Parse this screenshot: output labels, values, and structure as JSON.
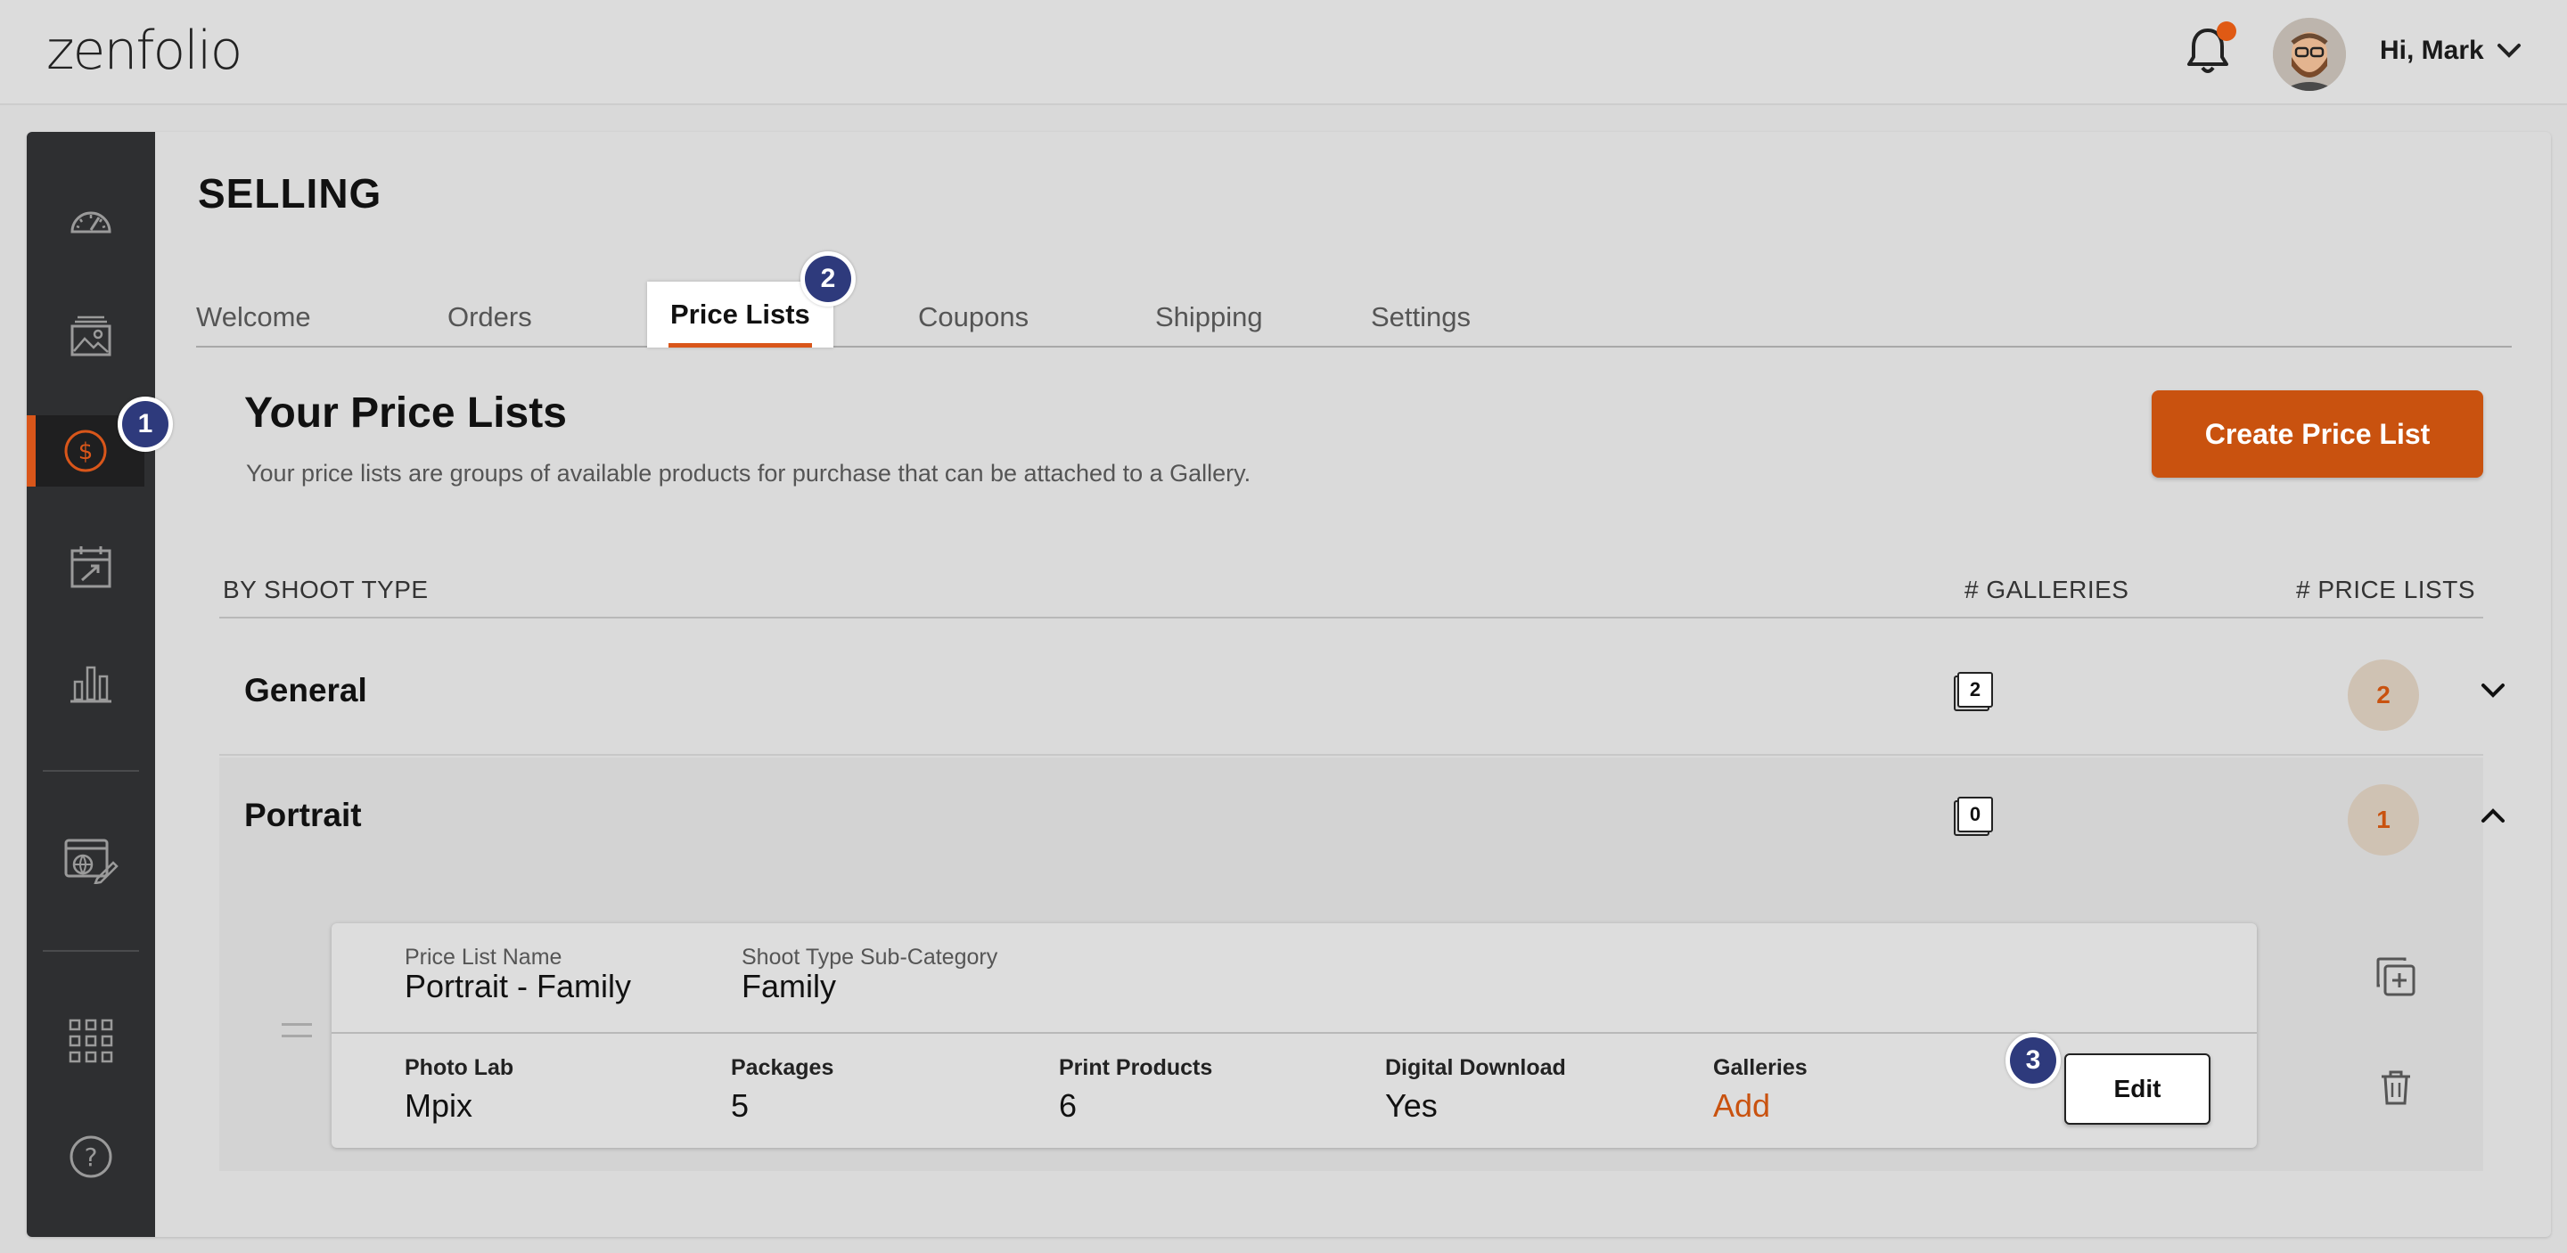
{
  "app": {
    "logo_text": "zenfolio",
    "greeting": "Hi, Mark"
  },
  "page": {
    "title": "SELLING"
  },
  "tabs": [
    {
      "label": "Welcome"
    },
    {
      "label": "Orders"
    },
    {
      "label": "Price Lists",
      "active": true
    },
    {
      "label": "Coupons"
    },
    {
      "label": "Shipping"
    },
    {
      "label": "Settings"
    }
  ],
  "sidebar": {
    "items": [
      {
        "icon": "dashboard-icon"
      },
      {
        "icon": "gallery-icon"
      },
      {
        "icon": "selling-dollar-icon",
        "active": true
      },
      {
        "icon": "calendar-icon"
      },
      {
        "icon": "stats-icon"
      },
      {
        "icon": "website-editor-icon"
      },
      {
        "icon": "apps-grid-icon"
      },
      {
        "icon": "help-icon"
      }
    ]
  },
  "markers": {
    "m1": "1",
    "m2": "2",
    "m3": "3"
  },
  "section": {
    "title": "Your Price Lists",
    "subtitle": "Your price lists are groups of available products for purchase that can be attached to a Gallery.",
    "create_button": "Create Price List"
  },
  "table": {
    "headers": {
      "shoot_type": "BY SHOOT TYPE",
      "galleries": "# GALLERIES",
      "price_lists": "# PRICE LISTS"
    },
    "groups": [
      {
        "name": "General",
        "galleries": "2",
        "price_lists": "2",
        "expanded": false
      },
      {
        "name": "Portrait",
        "galleries": "0",
        "price_lists": "1",
        "expanded": true
      }
    ]
  },
  "price_list": {
    "name_label": "Price List Name",
    "name_value": "Portrait - Family",
    "subcat_label": "Shoot Type Sub-Category",
    "subcat_value": "Family",
    "photo_lab_label": "Photo Lab",
    "photo_lab_value": "Mpix",
    "packages_label": "Packages",
    "packages_value": "5",
    "print_label": "Print Products",
    "print_value": "6",
    "digital_label": "Digital Download",
    "digital_value": "Yes",
    "galleries_label": "Galleries",
    "galleries_value": "Add",
    "edit_button": "Edit"
  },
  "colors": {
    "accent": "#c9520f",
    "sidebar_bg": "#2e2f31",
    "marker": "#2e3a7c"
  }
}
